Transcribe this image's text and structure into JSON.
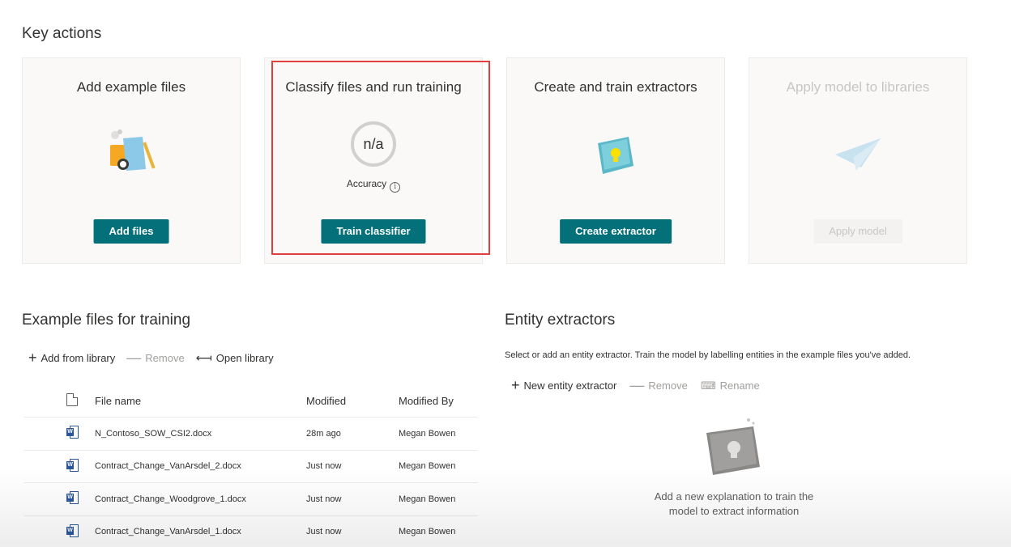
{
  "key_actions": {
    "title": "Key actions",
    "cards": [
      {
        "title": "Add example files",
        "button": "Add files"
      },
      {
        "title": "Classify files and run training",
        "ring_value": "n/a",
        "accuracy_label": "Accuracy",
        "button": "Train classifier"
      },
      {
        "title": "Create and train extractors",
        "button": "Create extractor"
      },
      {
        "title": "Apply model to libraries",
        "button": "Apply model",
        "disabled": true
      }
    ]
  },
  "example_files": {
    "title": "Example files for training",
    "commands": {
      "add": "Add from library",
      "remove": "Remove",
      "open": "Open library"
    },
    "columns": {
      "name": "File name",
      "modified": "Modified",
      "modified_by": "Modified By"
    },
    "rows": [
      {
        "name": "N_Contoso_SOW_CSI2.docx",
        "modified": "28m ago",
        "modified_by": "Megan Bowen"
      },
      {
        "name": "Contract_Change_VanArsdel_2.docx",
        "modified": "Just now",
        "modified_by": "Megan Bowen"
      },
      {
        "name": "Contract_Change_Woodgrove_1.docx",
        "modified": "Just now",
        "modified_by": "Megan Bowen"
      },
      {
        "name": "Contract_Change_VanArsdel_1.docx",
        "modified": "Just now",
        "modified_by": "Megan Bowen"
      }
    ]
  },
  "entity_extractors": {
    "title": "Entity extractors",
    "description": "Select or add an entity extractor. Train the model by labelling entities in the example files you've added.",
    "commands": {
      "new": "New entity extractor",
      "remove": "Remove",
      "rename": "Rename"
    },
    "empty_line1": "Add a new explanation to train the",
    "empty_line2": "model to extract information"
  },
  "colors": {
    "accent": "#03707a",
    "highlight": "#e0413f"
  }
}
